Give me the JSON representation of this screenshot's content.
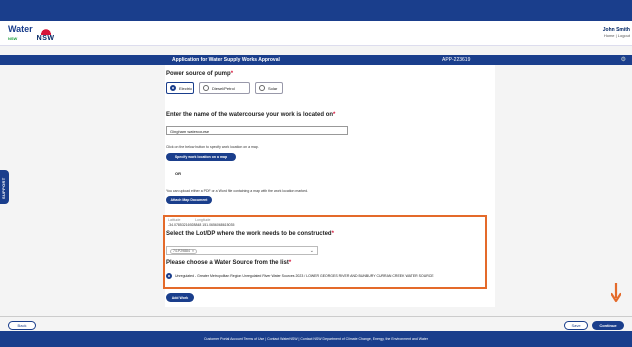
{
  "header": {
    "logo_water": "Water",
    "logo_water_sub": "NSW",
    "logo_nsw": "NSW",
    "user_name": "John Smith",
    "user_links": "Home | Logout"
  },
  "appbar": {
    "title": "Application for Water Supply Works Approval",
    "app_number": "APP-223619"
  },
  "support_tab": "SUPPORT",
  "power": {
    "heading": "Power source of pump",
    "required_mark": "*",
    "options": [
      "Electric",
      "Diesel/Petrol",
      "Solar"
    ],
    "selected": "Electric"
  },
  "watercourse": {
    "heading": "Enter the name of the watercourse your work is located on",
    "required_mark": "*",
    "value": "Gingham watercourse"
  },
  "map": {
    "instruction": "Click on the below button to specify work location on a map.",
    "button": "Specify work location on a map",
    "or": "OR",
    "upload_instruction": "You can upload either a PDF or a Word file containing a map with the work location marked.",
    "attach_button": "Attach Map Document"
  },
  "location": {
    "latitude_label": "Latitude",
    "latitude": "-34.07853216928848",
    "longitude_label": "Longitude",
    "longitude": "151.0656068615035"
  },
  "lot": {
    "heading": "Select the Lot/DP where the work needs to be constructed",
    "required_mark": "*",
    "chip": "7/1P29884"
  },
  "water_source": {
    "heading": "Please choose a Water Source from the list",
    "required_mark": "*",
    "option": "Unregulated - Greater Metropolitan Region Unregulated River Water Sources 2023 / LOWER GEORGES RIVER AND BUNBURY CURRAN CREEK WATER SOURCE"
  },
  "add_work": "Add Work",
  "nav": {
    "back": "Back",
    "save": "Save",
    "continue": "Continue"
  },
  "footer": "Customer Portal Account Terms of Use | Contact WaterNSW | Contact NSW Department of Climate Change, Energy, the Environment and Water",
  "colors": {
    "primary": "#1a3e8c",
    "highlight": "#e46a2a",
    "required": "#d7153a"
  }
}
